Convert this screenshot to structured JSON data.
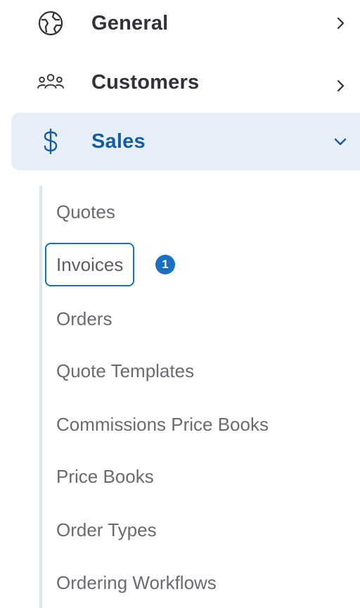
{
  "nav": {
    "general": {
      "label": "General",
      "icon": "globe-icon",
      "state": "collapsed"
    },
    "customers": {
      "label": "Customers",
      "icon": "users-icon",
      "state": "collapsed"
    },
    "sales": {
      "label": "Sales",
      "icon": "dollar-icon",
      "state": "expanded"
    }
  },
  "sales_submenu": {
    "items": [
      {
        "label": "Quotes"
      },
      {
        "label": "Invoices",
        "focused": true,
        "badge": "1"
      },
      {
        "label": "Orders"
      },
      {
        "label": "Quote Templates"
      },
      {
        "label": "Commissions Price Books"
      },
      {
        "label": "Price Books"
      },
      {
        "label": "Order Types"
      },
      {
        "label": "Ordering Workflows"
      }
    ]
  },
  "colors": {
    "active_bg": "#e6eef7",
    "accent": "#1a6fc0",
    "active_text": "#175ca1",
    "nav_text": "#2f3338",
    "sub_text": "#686c70"
  }
}
